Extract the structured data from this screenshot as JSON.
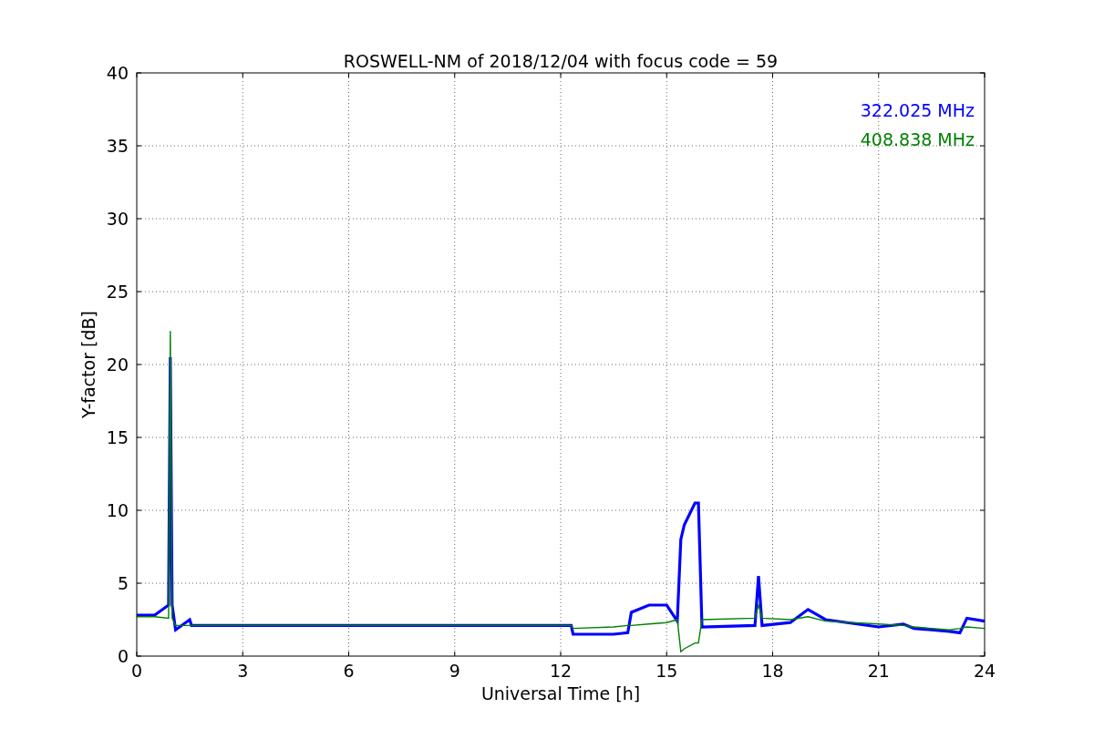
{
  "figure": {
    "chart_data": {
      "type": "line",
      "title": "ROSWELL-NM of 2018/12/04 with focus code = 59",
      "xlabel": "Universal Time [h]",
      "ylabel": "Y-factor [dB]",
      "x": [
        0,
        0.5,
        0.9,
        0.95,
        1.0,
        1.1,
        1.5,
        1.55,
        12.3,
        12.35,
        13.5,
        13.9,
        14.0,
        14.5,
        15.0,
        15.3,
        15.4,
        15.5,
        15.8,
        15.9,
        16.0,
        17.5,
        17.6,
        17.7,
        18.5,
        19.0,
        19.5,
        21.0,
        21.7,
        22.0,
        23.0,
        23.3,
        23.5,
        24
      ],
      "series": [
        {
          "name": "322.025 MHz",
          "color": "#0000ff",
          "values": [
            2.8,
            2.8,
            3.5,
            20.5,
            3.5,
            1.8,
            2.5,
            2.1,
            2.1,
            1.5,
            1.5,
            1.6,
            3.0,
            3.5,
            3.5,
            2.4,
            8.0,
            9.0,
            10.5,
            10.5,
            2.0,
            2.1,
            5.5,
            2.1,
            2.3,
            3.2,
            2.5,
            2.0,
            2.2,
            1.9,
            1.7,
            1.6,
            2.6,
            2.4
          ]
        },
        {
          "name": "408.838 MHz",
          "color": "#008000",
          "values": [
            2.7,
            2.7,
            2.6,
            22.3,
            2.6,
            2.1,
            2.1,
            2.1,
            2.1,
            1.9,
            2.0,
            2.1,
            2.1,
            2.2,
            2.3,
            2.5,
            0.3,
            0.5,
            0.9,
            0.9,
            2.5,
            2.6,
            3.5,
            2.6,
            2.5,
            2.7,
            2.4,
            2.2,
            2.1,
            2.0,
            1.8,
            1.9,
            2.0,
            1.9
          ]
        }
      ],
      "xlim": [
        0,
        24
      ],
      "ylim": [
        0,
        40
      ],
      "xticks": [
        0,
        3,
        6,
        9,
        12,
        15,
        18,
        21,
        24
      ],
      "yticks": [
        0,
        5,
        10,
        15,
        20,
        25,
        30,
        35,
        40
      ],
      "grid": true
    }
  }
}
